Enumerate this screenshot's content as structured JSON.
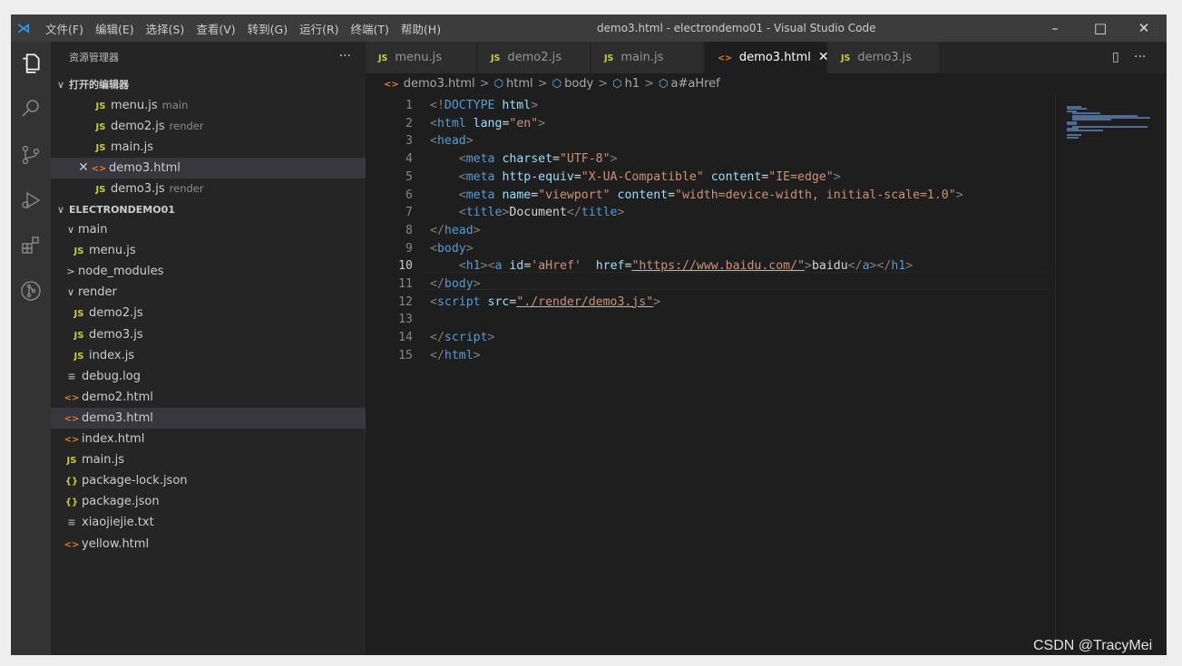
{
  "window": {
    "title": "demo3.html - electrondemo01 - Visual Studio Code",
    "menus": [
      "文件(F)",
      "编辑(E)",
      "选择(S)",
      "查看(V)",
      "转到(G)",
      "运行(R)",
      "终端(T)",
      "帮助(H)"
    ],
    "controls": {
      "minimize": "–",
      "maximize": "□",
      "close": "✕"
    }
  },
  "activity_bar": [
    "explorer-icon",
    "search-icon",
    "source-control-icon",
    "run-debug-icon",
    "extensions-icon",
    "git-graph-icon"
  ],
  "sidebar": {
    "title": "资源管理器",
    "more": "···",
    "open_editors": {
      "header": "打开的编辑器",
      "items": [
        {
          "name": "menu.js",
          "hint": "main",
          "icon": "JS",
          "kind": "js"
        },
        {
          "name": "demo2.js",
          "hint": "render",
          "icon": "JS",
          "kind": "js"
        },
        {
          "name": "main.js",
          "hint": "",
          "icon": "JS",
          "kind": "js"
        },
        {
          "name": "demo3.html",
          "hint": "",
          "icon": "<>",
          "kind": "html",
          "active": true,
          "close": "✕"
        },
        {
          "name": "demo3.js",
          "hint": "render",
          "icon": "JS",
          "kind": "js"
        }
      ]
    },
    "project": {
      "header": "ELECTRONDEMO01",
      "items": [
        {
          "name": "main",
          "kind": "folder",
          "open": true,
          "twisty": "∨"
        },
        {
          "name": "menu.js",
          "kind": "js",
          "icon": "JS"
        },
        {
          "name": "node_modules",
          "kind": "folder",
          "open": false,
          "twisty": ">"
        },
        {
          "name": "render",
          "kind": "folder",
          "open": true,
          "twisty": "∨"
        },
        {
          "name": "demo2.js",
          "kind": "js",
          "icon": "JS"
        },
        {
          "name": "demo3.js",
          "kind": "js",
          "icon": "JS"
        },
        {
          "name": "index.js",
          "kind": "js",
          "icon": "JS"
        },
        {
          "name": "debug.log",
          "kind": "txt",
          "icon": "≡"
        },
        {
          "name": "demo2.html",
          "kind": "html",
          "icon": "<>"
        },
        {
          "name": "demo3.html",
          "kind": "html",
          "icon": "<>",
          "selected": true
        },
        {
          "name": "index.html",
          "kind": "html",
          "icon": "<>"
        },
        {
          "name": "main.js",
          "kind": "js",
          "icon": "JS"
        },
        {
          "name": "package-lock.json",
          "kind": "json",
          "icon": "{}"
        },
        {
          "name": "package.json",
          "kind": "json",
          "icon": "{}"
        },
        {
          "name": "xiaojiejie.txt",
          "kind": "txt",
          "icon": "≡"
        },
        {
          "name": "yellow.html",
          "kind": "html",
          "icon": "<>"
        }
      ]
    }
  },
  "tabs": [
    {
      "label": "menu.js",
      "icon": "JS",
      "kind": "js"
    },
    {
      "label": "demo2.js",
      "icon": "JS",
      "kind": "js"
    },
    {
      "label": "main.js",
      "icon": "JS",
      "kind": "js"
    },
    {
      "label": "demo3.html",
      "icon": "<>",
      "kind": "html",
      "active": true,
      "close": "✕"
    },
    {
      "label": "demo3.js",
      "icon": "JS",
      "kind": "js"
    }
  ],
  "tab_actions": {
    "split": "▯",
    "more": "···"
  },
  "breadcrumbs": {
    "file": "demo3.html",
    "file_icon": "<>",
    "symbols": [
      "html",
      "body",
      "h1",
      "a#aHref"
    ],
    "separator": ">"
  },
  "editor": {
    "current_line": 10,
    "lines": [
      {
        "n": "1",
        "tokens": [
          [
            "br",
            "<!"
          ],
          [
            "tag",
            "DOCTYPE"
          ],
          [
            "text",
            " "
          ],
          [
            "attr",
            "html"
          ],
          [
            "br",
            ">"
          ]
        ]
      },
      {
        "n": "2",
        "tokens": [
          [
            "br",
            "<"
          ],
          [
            "tag",
            "html"
          ],
          [
            "text",
            " "
          ],
          [
            "attr",
            "lang"
          ],
          [
            "text",
            "="
          ],
          [
            "str",
            "\"en\""
          ],
          [
            "br",
            ">"
          ]
        ]
      },
      {
        "n": "3",
        "tokens": [
          [
            "br",
            "<"
          ],
          [
            "tag",
            "head"
          ],
          [
            "br",
            ">"
          ]
        ]
      },
      {
        "n": "4",
        "tokens": [
          [
            "text",
            "    "
          ],
          [
            "br",
            "<"
          ],
          [
            "tag",
            "meta"
          ],
          [
            "text",
            " "
          ],
          [
            "attr",
            "charset"
          ],
          [
            "text",
            "="
          ],
          [
            "str",
            "\"UTF-8\""
          ],
          [
            "br",
            ">"
          ]
        ]
      },
      {
        "n": "5",
        "tokens": [
          [
            "text",
            "    "
          ],
          [
            "br",
            "<"
          ],
          [
            "tag",
            "meta"
          ],
          [
            "text",
            " "
          ],
          [
            "attr",
            "http-equiv"
          ],
          [
            "text",
            "="
          ],
          [
            "str",
            "\"X-UA-Compatible\""
          ],
          [
            "text",
            " "
          ],
          [
            "attr",
            "content"
          ],
          [
            "text",
            "="
          ],
          [
            "str",
            "\"IE=edge\""
          ],
          [
            "br",
            ">"
          ]
        ]
      },
      {
        "n": "6",
        "tokens": [
          [
            "text",
            "    "
          ],
          [
            "br",
            "<"
          ],
          [
            "tag",
            "meta"
          ],
          [
            "text",
            " "
          ],
          [
            "attr",
            "name"
          ],
          [
            "text",
            "="
          ],
          [
            "str",
            "\"viewport\""
          ],
          [
            "text",
            " "
          ],
          [
            "attr",
            "content"
          ],
          [
            "text",
            "="
          ],
          [
            "str",
            "\"width=device-width, initial-scale=1.0\""
          ],
          [
            "br",
            ">"
          ]
        ]
      },
      {
        "n": "7",
        "tokens": [
          [
            "text",
            "    "
          ],
          [
            "br",
            "<"
          ],
          [
            "tag",
            "title"
          ],
          [
            "br",
            ">"
          ],
          [
            "text",
            "Document"
          ],
          [
            "br",
            "</"
          ],
          [
            "tag",
            "title"
          ],
          [
            "br",
            ">"
          ]
        ]
      },
      {
        "n": "8",
        "tokens": [
          [
            "br",
            "</"
          ],
          [
            "tag",
            "head"
          ],
          [
            "br",
            ">"
          ]
        ]
      },
      {
        "n": "9",
        "tokens": [
          [
            "br",
            "<"
          ],
          [
            "tag",
            "body"
          ],
          [
            "br",
            ">"
          ]
        ]
      },
      {
        "n": "10",
        "tokens": [
          [
            "text",
            "    "
          ],
          [
            "br",
            "<"
          ],
          [
            "tag",
            "h1"
          ],
          [
            "br",
            ">"
          ],
          [
            "br",
            "<"
          ],
          [
            "tag",
            "a"
          ],
          [
            "text",
            " "
          ],
          [
            "attr",
            "id"
          ],
          [
            "text",
            "="
          ],
          [
            "str",
            "'aHref'"
          ],
          [
            "text",
            "  "
          ],
          [
            "attr",
            "href"
          ],
          [
            "text",
            "="
          ],
          [
            "str",
            "\"https://www.baidu.com/\""
          ],
          [
            "br",
            ">"
          ],
          [
            "text",
            "baidu"
          ],
          [
            "br",
            "</"
          ],
          [
            "tag",
            "a"
          ],
          [
            "br",
            "></"
          ],
          [
            "tag",
            "h1"
          ],
          [
            "br",
            ">"
          ]
        ]
      },
      {
        "n": "11",
        "tokens": [
          [
            "br",
            "</"
          ],
          [
            "tag",
            "body"
          ],
          [
            "br",
            ">"
          ]
        ]
      },
      {
        "n": "12",
        "tokens": [
          [
            "br",
            "<"
          ],
          [
            "tag",
            "script"
          ],
          [
            "text",
            " "
          ],
          [
            "attr",
            "src"
          ],
          [
            "text",
            "="
          ],
          [
            "str",
            "\"./render/demo3.js\""
          ],
          [
            "br",
            ">"
          ]
        ]
      },
      {
        "n": "13",
        "tokens": []
      },
      {
        "n": "14",
        "tokens": [
          [
            "br",
            "</"
          ],
          [
            "tag",
            "script"
          ],
          [
            "br",
            ">"
          ]
        ]
      },
      {
        "n": "15",
        "tokens": [
          [
            "br",
            "</"
          ],
          [
            "tag",
            "html"
          ],
          [
            "br",
            ">"
          ]
        ]
      }
    ]
  },
  "watermark": "CSDN @TracyMei"
}
